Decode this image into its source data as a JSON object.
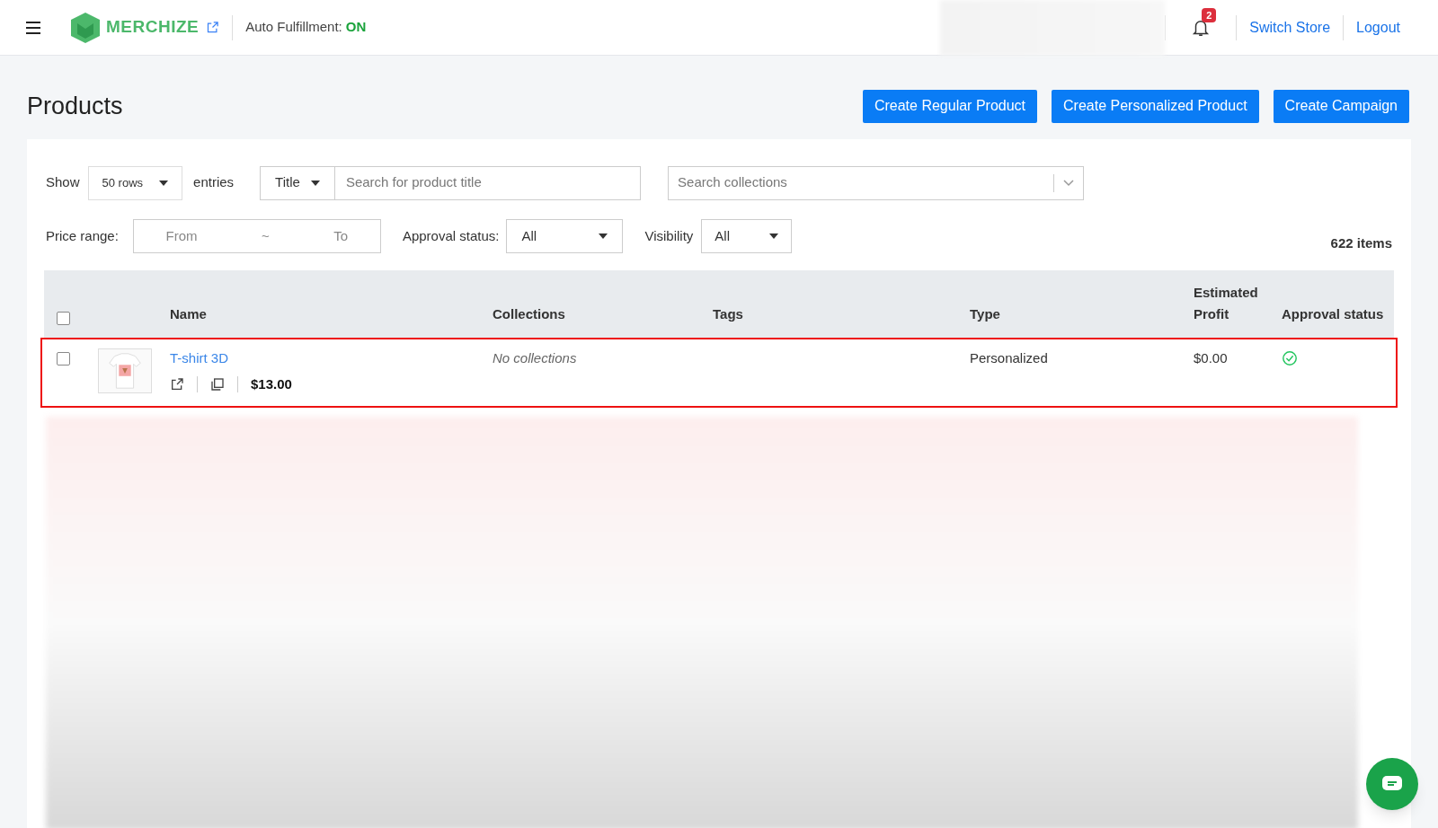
{
  "header": {
    "logo": "MERCHIZE",
    "auto_fulfillment_label": "Auto Fulfillment:",
    "auto_fulfillment_value": "ON",
    "notification_count": "2",
    "links": [
      "Switch Store",
      "Logout"
    ]
  },
  "page": {
    "title": "Products",
    "actions": [
      "Create Regular Product",
      "Create Personalized Product",
      "Create Campaign"
    ]
  },
  "filters": {
    "show_label": "Show",
    "rows": "50 rows",
    "entries_label": "entries",
    "search_by": "Title",
    "search_placeholder": "Search for product title",
    "collections_placeholder": "Search collections",
    "price_label": "Price range:",
    "price_from": "From",
    "price_sep": "~",
    "price_to": "To",
    "approval_label": "Approval status:",
    "approval_value": "All",
    "visibility_label": "Visibility",
    "visibility_value": "All",
    "count": "622 items"
  },
  "table": {
    "select_all_checked": false,
    "columns": [
      "Name",
      "Collections",
      "Tags",
      "Type",
      "Estimated Profit",
      "Approval status"
    ],
    "rows": [
      {
        "checked": false,
        "highlighted": true,
        "name": "T-shirt 3D",
        "price": "$13.00",
        "collections": "No collections",
        "type": "Personalized",
        "profit": "$0.00",
        "approved": true
      }
    ]
  }
}
